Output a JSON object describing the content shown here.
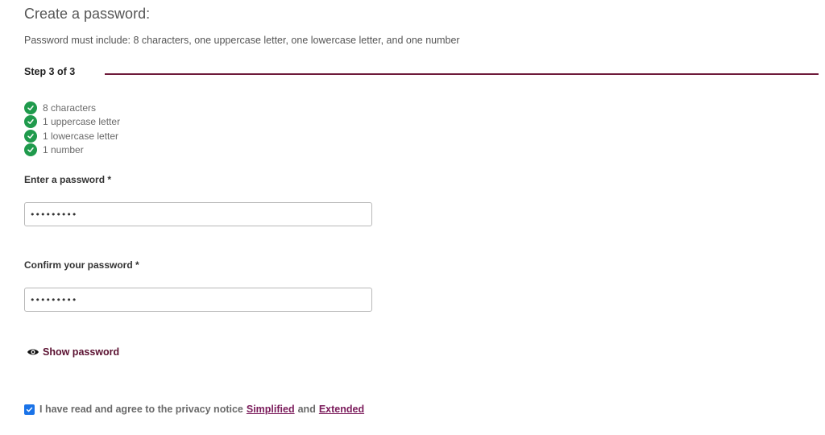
{
  "header": {
    "title": "Create a password:",
    "subtitle": "Password must include: 8 characters, one uppercase letter, one lowercase letter, and one number"
  },
  "progress": {
    "step_label": "Step 3 of 3",
    "line_color": "#6e1a3a"
  },
  "requirements": [
    {
      "label": "8 characters",
      "met": true,
      "icon": "check-circle-icon"
    },
    {
      "label": "1 uppercase letter",
      "met": true,
      "icon": "check-circle-icon"
    },
    {
      "label": "1 lowercase letter",
      "met": true,
      "icon": "check-circle-icon"
    },
    {
      "label": "1 number",
      "met": true,
      "icon": "check-circle-icon"
    }
  ],
  "password_field": {
    "label": "Enter a password *",
    "value": "•••••••••"
  },
  "confirm_field": {
    "label": "Confirm your password *",
    "value": "•••••••••"
  },
  "show_password": {
    "label": "Show password",
    "icon": "eye-icon"
  },
  "consent": {
    "checked": true,
    "text": "I have read and agree to the privacy notice",
    "link_simplified": "Simplified",
    "and_text": "and",
    "link_extended": "Extended"
  },
  "colors": {
    "success": "#1f9a4c",
    "accent": "#6e1a3a",
    "link": "#7a1a5a",
    "checkbox": "#1a73e8"
  }
}
